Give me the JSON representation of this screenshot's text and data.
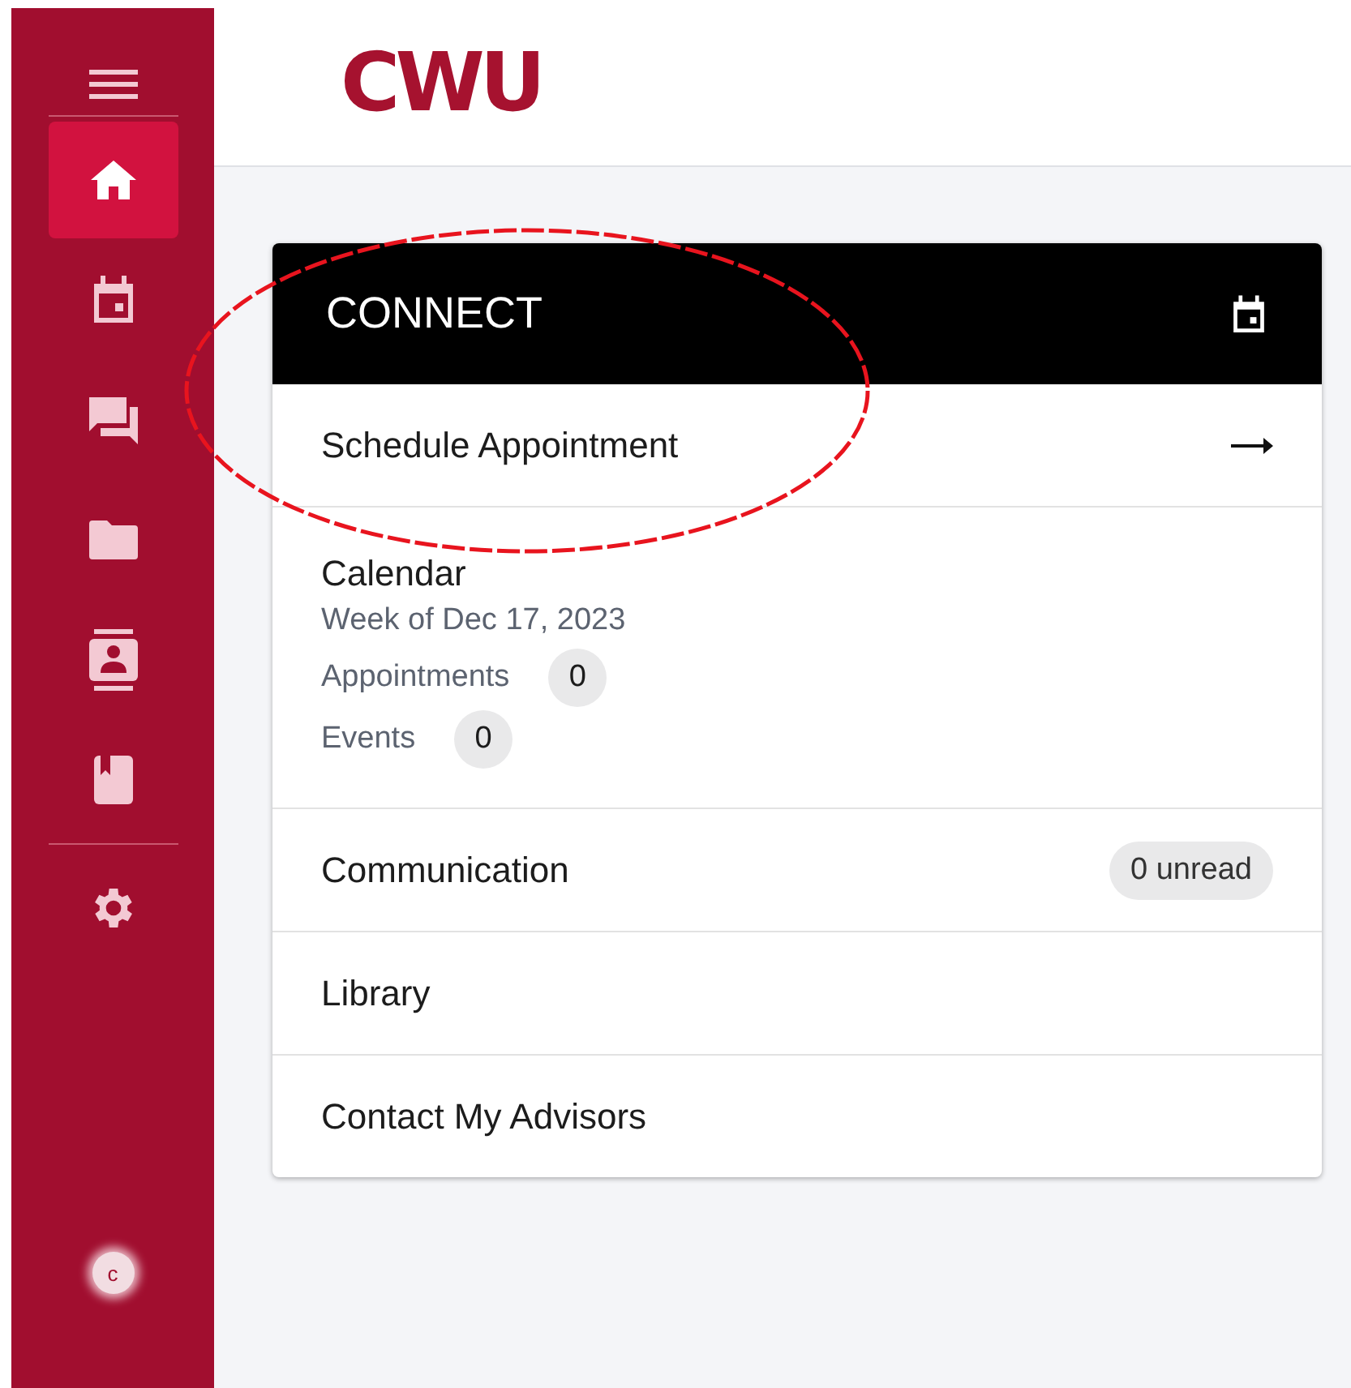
{
  "sidebar": {
    "items": [
      {
        "selected": true
      },
      {
        "selected": false
      },
      {
        "selected": false
      },
      {
        "selected": false
      },
      {
        "selected": false
      },
      {
        "selected": false
      }
    ],
    "footer_logo": "c"
  },
  "header": {
    "logo": "CWU"
  },
  "card": {
    "title": "CONNECT",
    "rows": [
      {
        "kind": "link",
        "label": "Schedule Appointment"
      },
      {
        "kind": "calendar",
        "label": "Calendar",
        "subtitle": "Week of Dec 17, 2023",
        "counts": [
          {
            "label": "Appointments",
            "value": "0"
          },
          {
            "label": "Events",
            "value": "0"
          }
        ]
      },
      {
        "kind": "badge",
        "label": "Communication",
        "badge": "0 unread"
      },
      {
        "kind": "plain",
        "label": "Library"
      },
      {
        "kind": "plain",
        "label": "Contact My Advisors"
      }
    ]
  }
}
